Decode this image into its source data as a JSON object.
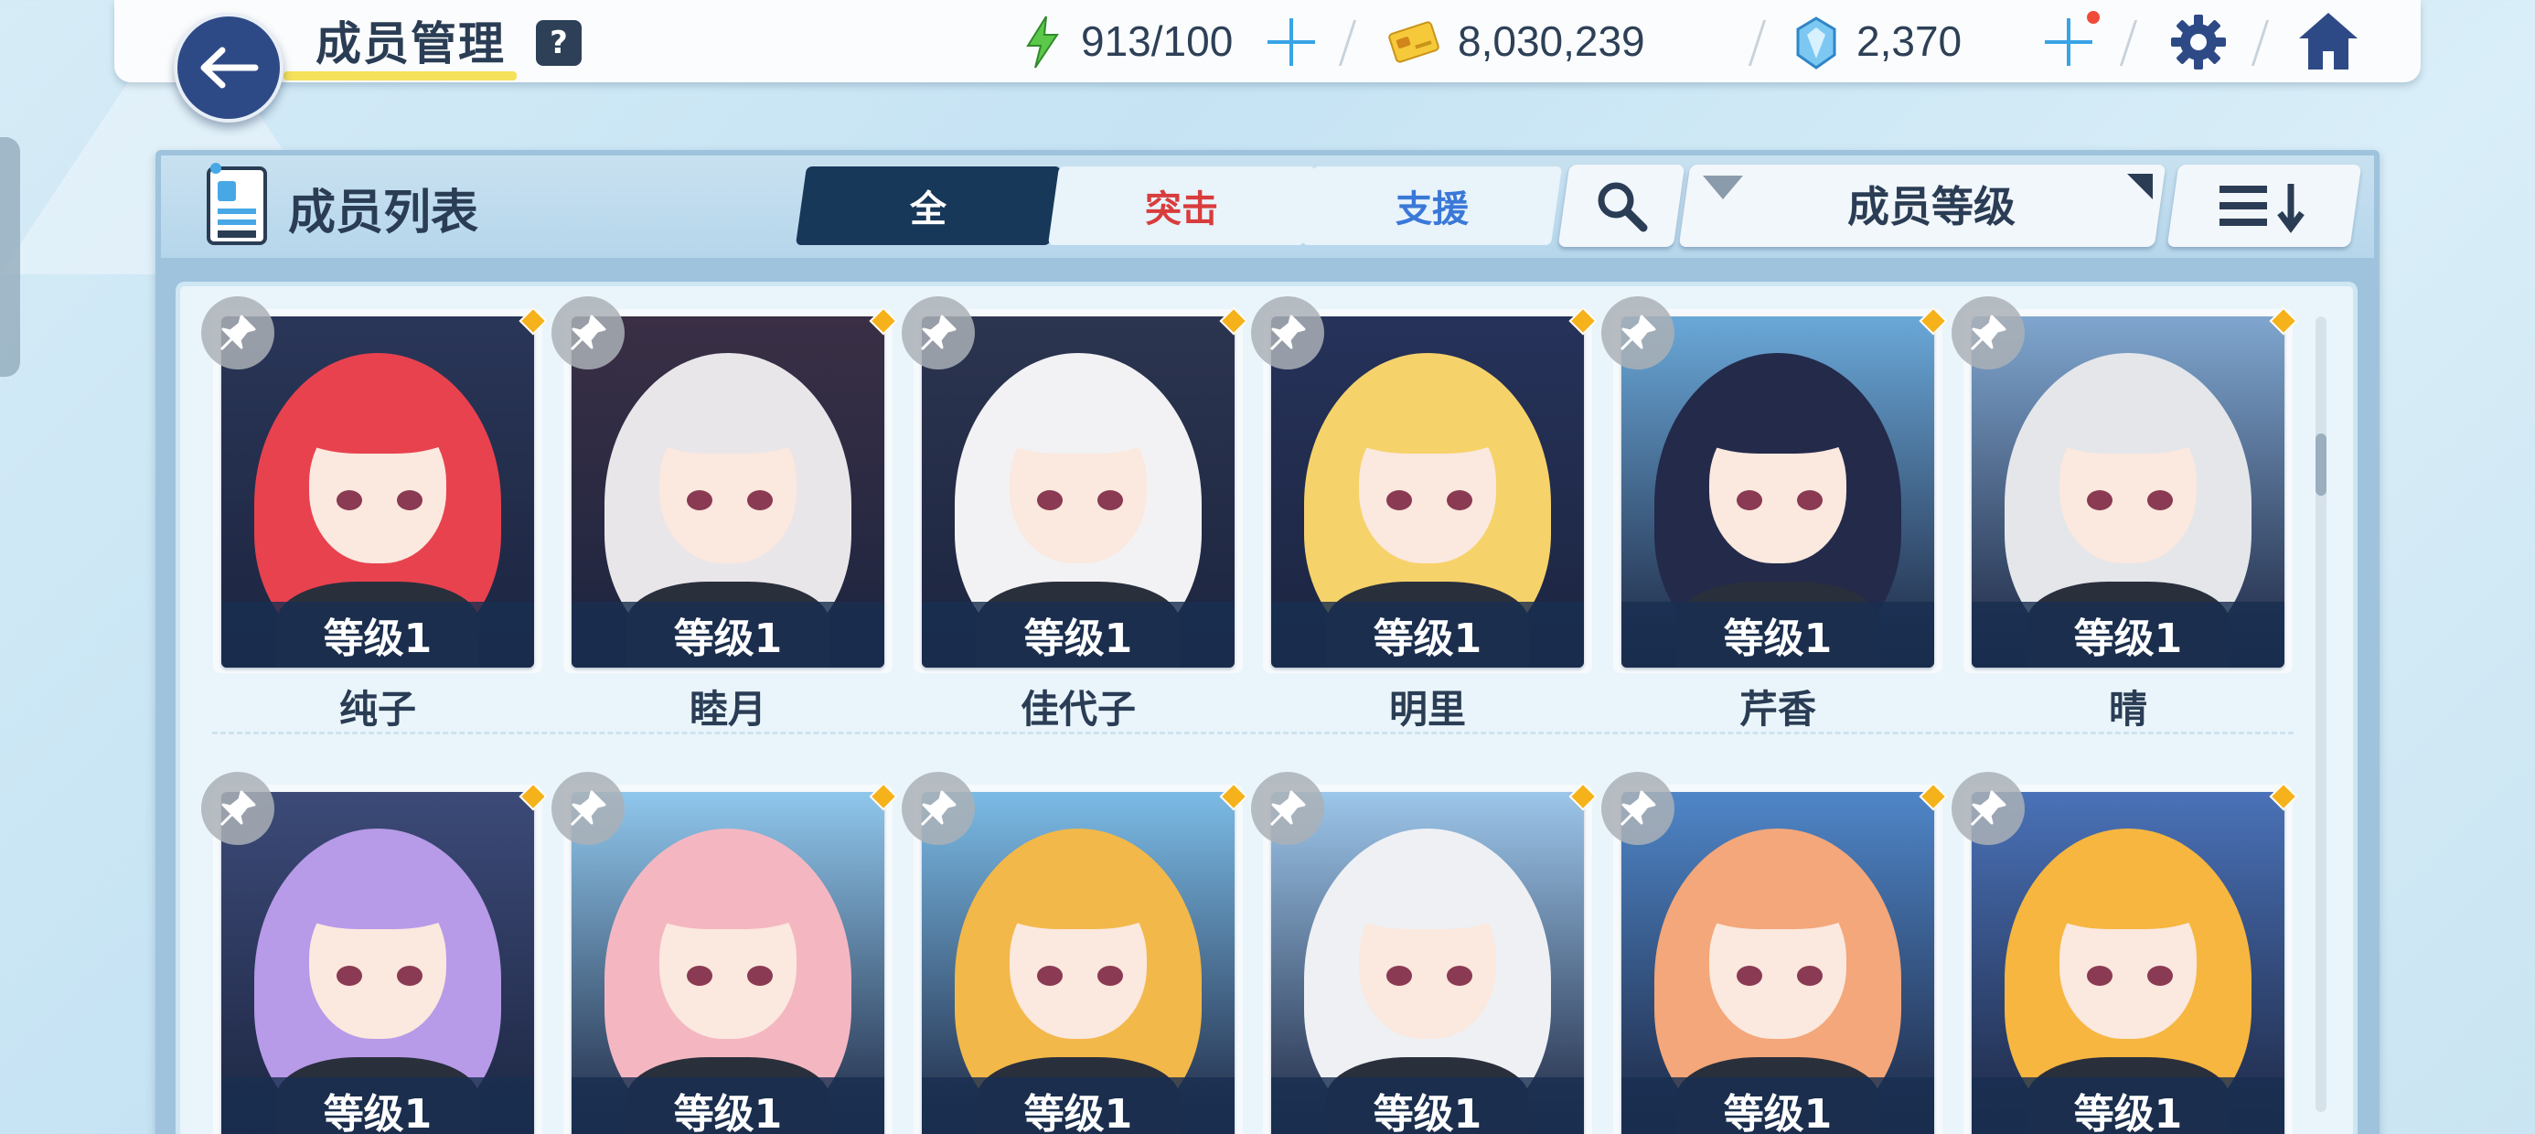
{
  "header": {
    "title": "成员管理",
    "help": "?",
    "ap": "913/100",
    "credits": "8,030,239",
    "gems": "2,370"
  },
  "panel": {
    "title": "成员列表",
    "tabs": [
      "全",
      "突击",
      "支援"
    ],
    "filter_label": "成员等级"
  },
  "members": [
    {
      "name": "纯子",
      "level": "等级1",
      "hair": "#e8424f",
      "bg": "#2a3658",
      "favorite": true
    },
    {
      "name": "睦月",
      "level": "等级1",
      "hair": "#e9e6ea",
      "bg": "#3a2f45",
      "favorite": true
    },
    {
      "name": "佳代子",
      "level": "等级1",
      "hair": "#f2f2f4",
      "bg": "#2c3550",
      "favorite": true
    },
    {
      "name": "明里",
      "level": "等级1",
      "hair": "#f6d26a",
      "bg": "#26325a",
      "favorite": true
    },
    {
      "name": "芹香",
      "level": "等级1",
      "hair": "#242a4a",
      "bg": "#6aa8d8",
      "favorite": true
    },
    {
      "name": "晴",
      "level": "等级1",
      "hair": "#e4e6ea",
      "bg": "#7fa6cf",
      "favorite": true
    },
    {
      "name": "",
      "level": "等级1",
      "hair": "#b79ae8",
      "bg": "#3c4a78",
      "favorite": true
    },
    {
      "name": "",
      "level": "等级1",
      "hair": "#f4b7c1",
      "bg": "#8fc7ec",
      "favorite": true
    },
    {
      "name": "",
      "level": "等级1",
      "hair": "#f2b84a",
      "bg": "#7bbbe6",
      "favorite": true
    },
    {
      "name": "",
      "level": "等级1",
      "hair": "#eef0f4",
      "bg": "#9cc6ea",
      "favorite": true
    },
    {
      "name": "",
      "level": "等级1",
      "hair": "#f3a77a",
      "bg": "#4f86c8",
      "favorite": true
    },
    {
      "name": "",
      "level": "等级1",
      "hair": "#f6b640",
      "bg": "#4a72b8",
      "favorite": true
    }
  ],
  "icons": {
    "back": "arrow-left-icon",
    "ap": "lightning-icon",
    "credits": "credit-card-icon",
    "gems": "gem-icon",
    "settings": "gear-icon",
    "home": "home-icon",
    "search": "search-icon",
    "filter": "filter-icon",
    "sort": "sort-desc-icon",
    "pin": "pin-icon"
  }
}
